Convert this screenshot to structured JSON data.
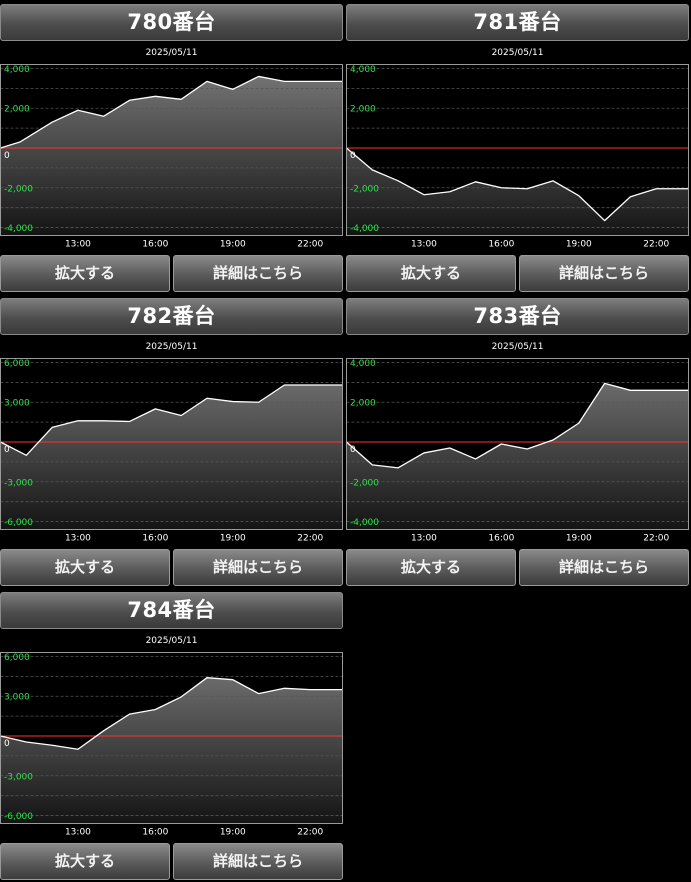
{
  "buttons": {
    "zoom": "拡大する",
    "detail": "詳細はこちら"
  },
  "charts": [
    {
      "title": "780番台",
      "date": "2025/05/11",
      "chart_data": {
        "type": "area",
        "x_ticks": [
          "13:00",
          "16:00",
          "19:00",
          "22:00"
        ],
        "x_range": [
          "10:00",
          "23:15"
        ],
        "ylim": [
          -4400,
          4200
        ],
        "y_ticks": [
          4000,
          2000,
          0,
          -2000,
          -4000
        ],
        "y_tick_labels": [
          "4,000",
          "2,000",
          "0",
          "-2,000",
          "-4,000"
        ],
        "zero_line_color": "#ff3030",
        "x_hours": [
          10,
          10.75,
          12,
          13,
          14,
          15,
          16,
          17,
          18,
          19,
          20,
          21,
          22,
          23.25
        ],
        "values": [
          0,
          300,
          1300,
          1900,
          1600,
          2400,
          2600,
          2450,
          3350,
          2950,
          3600,
          3350,
          3350,
          3350
        ]
      }
    },
    {
      "title": "781番台",
      "date": "2025/05/11",
      "chart_data": {
        "type": "area",
        "x_ticks": [
          "13:00",
          "16:00",
          "19:00",
          "22:00"
        ],
        "x_range": [
          "10:00",
          "23:15"
        ],
        "ylim": [
          -4400,
          4200
        ],
        "y_ticks": [
          4000,
          2000,
          0,
          -2000,
          -4000
        ],
        "y_tick_labels": [
          "4,000",
          "2,000",
          "0",
          "-2,000",
          "-4,000"
        ],
        "zero_line_color": "#ff3030",
        "x_hours": [
          10,
          11,
          12,
          13,
          14,
          15,
          16,
          17,
          18,
          19,
          20,
          21,
          22,
          23.25
        ],
        "values": [
          0,
          -1100,
          -1650,
          -2350,
          -2200,
          -1700,
          -2000,
          -2050,
          -1650,
          -2400,
          -3650,
          -2450,
          -2050,
          -2050
        ]
      }
    },
    {
      "title": "782番台",
      "date": "2025/05/11",
      "chart_data": {
        "type": "area",
        "x_ticks": [
          "13:00",
          "16:00",
          "19:00",
          "22:00"
        ],
        "x_range": [
          "10:00",
          "23:15"
        ],
        "ylim": [
          -6600,
          6300
        ],
        "y_ticks": [
          6000,
          3000,
          0,
          -3000,
          -6000
        ],
        "y_tick_labels": [
          "6,000",
          "3,000",
          "0",
          "-3,000",
          "-6,000"
        ],
        "zero_line_color": "#ff3030",
        "x_hours": [
          10,
          11,
          12,
          13,
          14,
          15,
          16,
          17,
          18,
          19,
          20,
          21,
          22,
          23.25
        ],
        "values": [
          0,
          -1000,
          1100,
          1600,
          1600,
          1550,
          2500,
          2000,
          3300,
          3050,
          3000,
          4300,
          4300,
          4300
        ]
      }
    },
    {
      "title": "783番台",
      "date": "2025/05/11",
      "chart_data": {
        "type": "area",
        "x_ticks": [
          "13:00",
          "16:00",
          "19:00",
          "22:00"
        ],
        "x_range": [
          "10:00",
          "23:15"
        ],
        "ylim": [
          -4400,
          4200
        ],
        "y_ticks": [
          4000,
          2000,
          0,
          -2000,
          -4000
        ],
        "y_tick_labels": [
          "4,000",
          "2,000",
          "0",
          "-2,000",
          "-4,000"
        ],
        "zero_line_color": "#ff3030",
        "x_hours": [
          10,
          11,
          12,
          13,
          14,
          15,
          16,
          17,
          18,
          19,
          20,
          21,
          22,
          23.25
        ],
        "values": [
          0,
          -1150,
          -1300,
          -550,
          -300,
          -850,
          -100,
          -350,
          100,
          950,
          2950,
          2600,
          2600,
          2600
        ]
      }
    },
    {
      "title": "784番台",
      "date": "2025/05/11",
      "chart_data": {
        "type": "area",
        "x_ticks": [
          "13:00",
          "16:00",
          "19:00",
          "22:00"
        ],
        "x_range": [
          "10:00",
          "23:15"
        ],
        "ylim": [
          -6600,
          6300
        ],
        "y_ticks": [
          6000,
          3000,
          0,
          -3000,
          -6000
        ],
        "y_tick_labels": [
          "6,000",
          "3,000",
          "0",
          "-3,000",
          "-6,000"
        ],
        "zero_line_color": "#ff3030",
        "x_hours": [
          10,
          11,
          12,
          13,
          14,
          15,
          16,
          17,
          18,
          19,
          20,
          21,
          22,
          23.25
        ],
        "values": [
          0,
          -450,
          -700,
          -1000,
          400,
          1650,
          2000,
          2950,
          4400,
          4250,
          3200,
          3600,
          3500,
          3500
        ]
      }
    }
  ]
}
